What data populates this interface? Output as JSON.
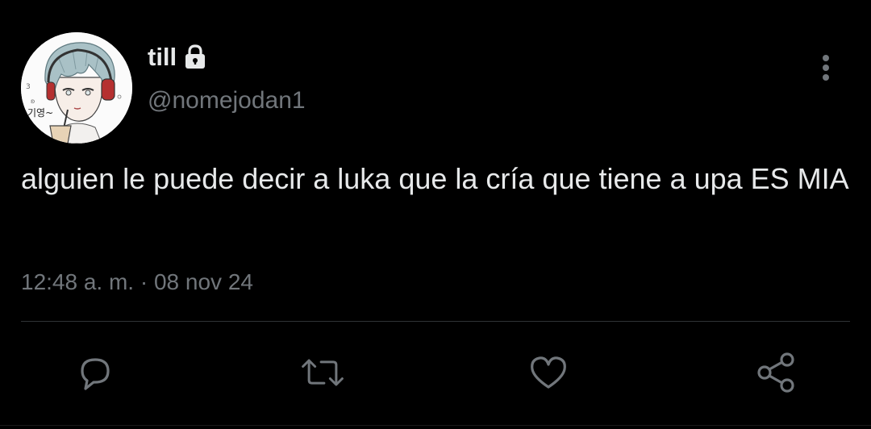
{
  "tweet": {
    "display_name": "till",
    "handle": "@nomejodan1",
    "text": "alguien le puede decir a luka que la cría que tiene a upa ES MIA",
    "time": "12:48 a. m.",
    "separator": "·",
    "date": "08 nov 24",
    "avatar_caption": "기영~"
  },
  "icons": {
    "lock": "lock-icon",
    "more": "more-vertical-icon",
    "reply": "reply-icon",
    "retweet": "retweet-icon",
    "like": "heart-icon",
    "share": "share-icon"
  },
  "colors": {
    "background": "#000000",
    "text_primary": "#e7e9ea",
    "text_secondary": "#71767b",
    "divider": "#2f3336"
  }
}
